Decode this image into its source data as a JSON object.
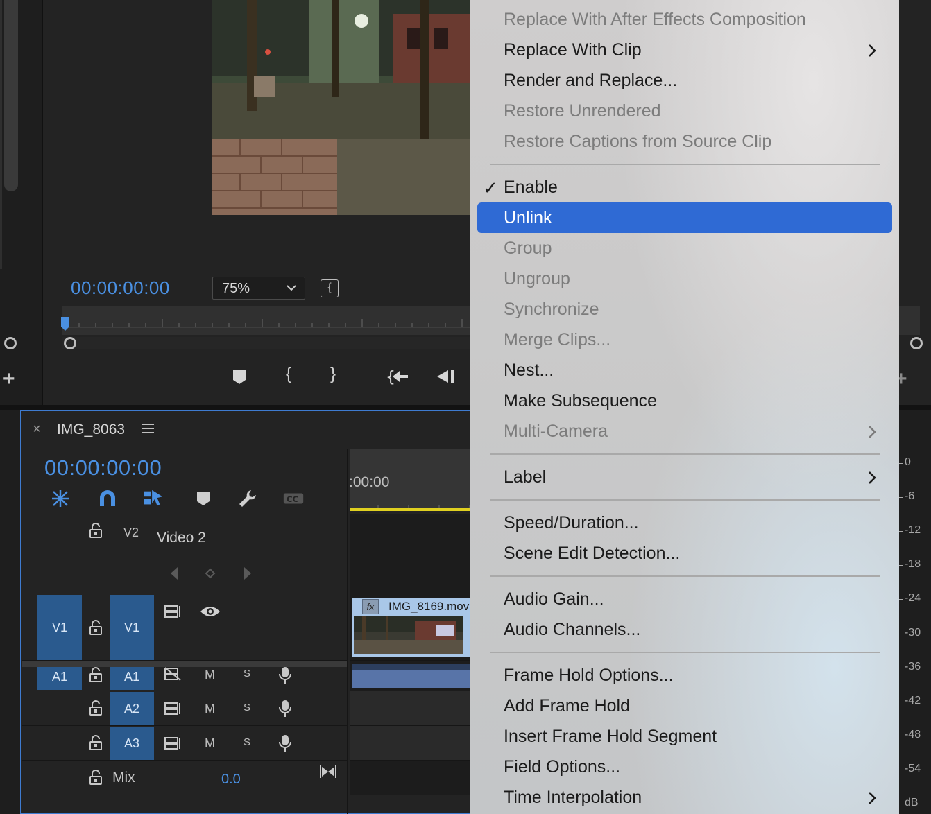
{
  "monitor": {
    "timecode": "00:00:00:00",
    "zoom": "75%"
  },
  "timeline": {
    "close": "×",
    "sequence_name": "IMG_8063",
    "timecode": "00:00:00:00",
    "ruler_timecode": ":00:00",
    "clip_name": "IMG_8169.mov",
    "fx_badge": "fx",
    "tracks": {
      "v2": {
        "label": "V2",
        "name": "Video 2"
      },
      "v1": {
        "source": "V1",
        "label": "V1"
      },
      "a1": {
        "source": "A1",
        "label": "A1",
        "m": "M",
        "s": "S"
      },
      "a2": {
        "label": "A2",
        "m": "M",
        "s": "S"
      },
      "a3": {
        "label": "A3",
        "m": "M",
        "s": "S"
      },
      "mix": {
        "label": "Mix",
        "value": "0.0"
      }
    }
  },
  "meter": {
    "scale": [
      "0",
      "-6",
      "-12",
      "-18",
      "-24",
      "-30",
      "-36",
      "-42",
      "-48",
      "-54",
      "dB"
    ]
  },
  "menu": {
    "items": [
      {
        "label": "Replace With After Effects Composition",
        "enabled": false
      },
      {
        "label": "Replace With Clip",
        "enabled": true,
        "submenu": true
      },
      {
        "label": "Render and Replace...",
        "enabled": true
      },
      {
        "label": "Restore Unrendered",
        "enabled": false
      },
      {
        "label": "Restore Captions from Source Clip",
        "enabled": false
      },
      {
        "label": "Enable",
        "enabled": true,
        "checked": true
      },
      {
        "label": "Unlink",
        "enabled": true,
        "highlighted": true
      },
      {
        "label": "Group",
        "enabled": false
      },
      {
        "label": "Ungroup",
        "enabled": false
      },
      {
        "label": "Synchronize",
        "enabled": false
      },
      {
        "label": "Merge Clips...",
        "enabled": false
      },
      {
        "label": "Nest...",
        "enabled": true
      },
      {
        "label": "Make Subsequence",
        "enabled": true
      },
      {
        "label": "Multi-Camera",
        "enabled": false,
        "submenu": true
      },
      {
        "label": "Label",
        "enabled": true,
        "submenu": true
      },
      {
        "label": "Speed/Duration...",
        "enabled": true
      },
      {
        "label": "Scene Edit Detection...",
        "enabled": true
      },
      {
        "label": "Audio Gain...",
        "enabled": true
      },
      {
        "label": "Audio Channels...",
        "enabled": true
      },
      {
        "label": "Frame Hold Options...",
        "enabled": true
      },
      {
        "label": "Add Frame Hold",
        "enabled": true
      },
      {
        "label": "Insert Frame Hold Segment",
        "enabled": true
      },
      {
        "label": "Field Options...",
        "enabled": true
      },
      {
        "label": "Time Interpolation",
        "enabled": true,
        "submenu": true
      }
    ],
    "check_glyph": "✓",
    "highlight_color": "#2f6ad4"
  },
  "colors": {
    "accent": "#4a90e2",
    "target_track": "#2a5a8e",
    "work_area": "#e0d020"
  }
}
